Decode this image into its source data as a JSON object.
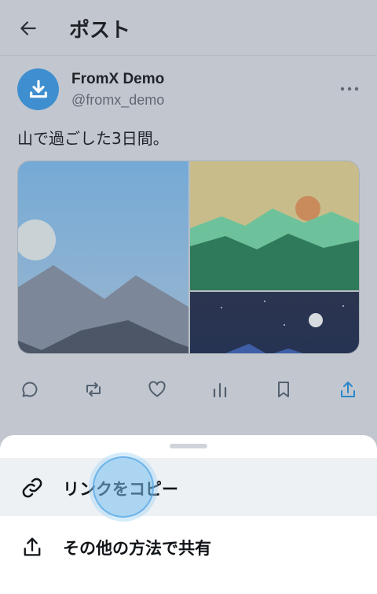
{
  "header": {
    "title": "ポスト",
    "back_icon": "arrow-left-icon"
  },
  "post": {
    "author_name": "FromX Demo",
    "author_handle": "@fromx_demo",
    "avatar_icon": "download-icon",
    "avatar_color": "#3f8fd0",
    "text": "山で過ごした3日間。",
    "images": [
      "mountain-morning-image",
      "mountain-sunset-image",
      "mountain-night-image"
    ]
  },
  "actions": [
    {
      "name": "reply",
      "icon": "reply-icon"
    },
    {
      "name": "repost",
      "icon": "repost-icon"
    },
    {
      "name": "like",
      "icon": "heart-icon"
    },
    {
      "name": "views",
      "icon": "analytics-icon"
    },
    {
      "name": "bookmark",
      "icon": "bookmark-icon"
    },
    {
      "name": "share",
      "icon": "share-icon",
      "color": "#1d9bf0"
    }
  ],
  "share_sheet": {
    "items": [
      {
        "label": "リンクをコピー",
        "icon": "link-icon"
      },
      {
        "label": "その他の方法で共有",
        "icon": "share-icon"
      }
    ]
  }
}
